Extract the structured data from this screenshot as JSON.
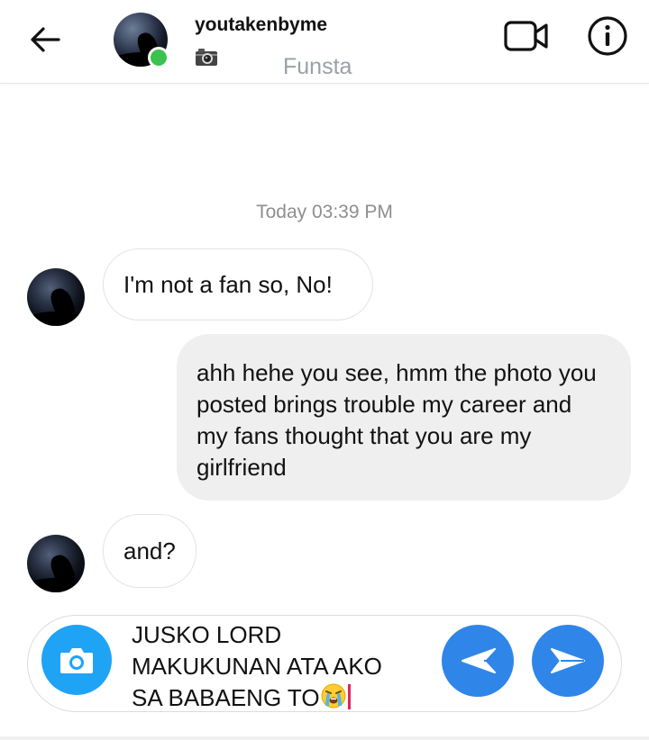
{
  "header": {
    "username": "youtakenbyme",
    "subtitle": "Funsta",
    "online_color": "#3cc24e",
    "icons": [
      "back-arrow-icon",
      "camera-emoji-icon",
      "video-call-icon",
      "info-icon"
    ]
  },
  "conversation": {
    "timestamp": "Today 03:39 PM",
    "messages": [
      {
        "sender": "them",
        "text": "I'm not a fan so, No!"
      },
      {
        "sender": "me",
        "text": "ahh hehe you see, hmm the photo you posted brings trouble my career and my fans thought that you are my girlfriend"
      },
      {
        "sender": "them",
        "text": "and?"
      }
    ]
  },
  "composer": {
    "lines": [
      "JUSKO LORD",
      "MAKUKUNAN ATA AKO",
      "SA BABAENG TO"
    ],
    "trailing_emoji": "crying-face",
    "camera_color": "#1fa3f5",
    "send_color": "#2f86e8",
    "icons": [
      "camera-icon",
      "arrow-left-icon",
      "send-icon"
    ]
  }
}
